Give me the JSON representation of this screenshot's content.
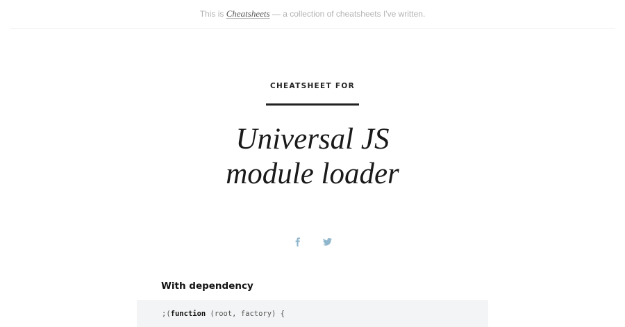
{
  "header": {
    "intro_prefix": "This is ",
    "site_name": "Cheatsheets",
    "intro_suffix": " — a collection of cheatsheets I've written."
  },
  "hero": {
    "kicker": "CHEATSHEET FOR",
    "title_line1": "Universal JS",
    "title_line2": "module loader"
  },
  "share": {
    "icons": [
      "facebook-icon",
      "twitter-icon"
    ],
    "accent_color": "#8fb6cc"
  },
  "section": {
    "heading": "With dependency",
    "code": {
      "punct_open": ";(",
      "keyword": "function",
      "rest": " (root, factory) {"
    }
  }
}
